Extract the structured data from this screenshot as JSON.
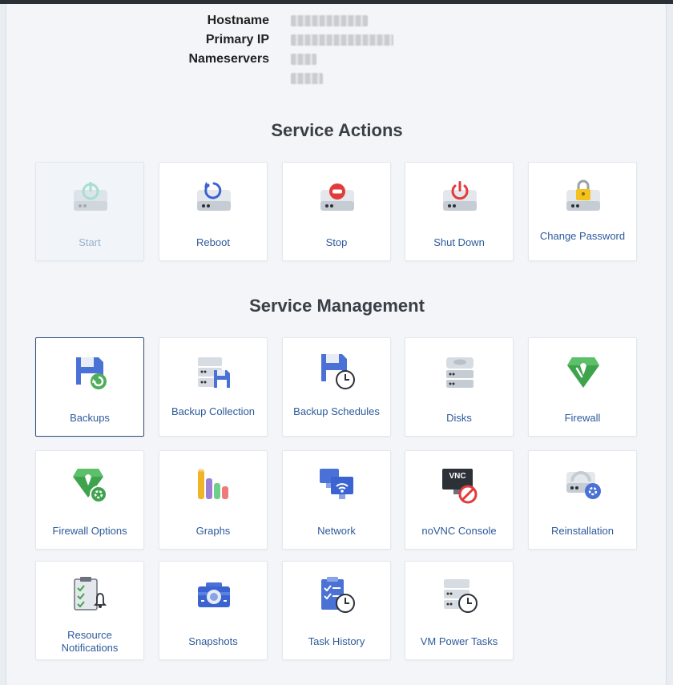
{
  "server_info": {
    "hostname_label": "Hostname",
    "primary_ip_label": "Primary IP",
    "nameservers_label": "Nameservers"
  },
  "service_actions": {
    "title": "Service Actions",
    "items": [
      {
        "label": "Start",
        "icon": "power-on-drive-icon",
        "enabled": false
      },
      {
        "label": "Reboot",
        "icon": "reboot-drive-icon",
        "enabled": true
      },
      {
        "label": "Stop",
        "icon": "stop-drive-icon",
        "enabled": true
      },
      {
        "label": "Shut Down",
        "icon": "shutdown-drive-icon",
        "enabled": true
      },
      {
        "label": "Change Password",
        "icon": "lock-drive-icon",
        "enabled": true
      }
    ]
  },
  "service_management": {
    "title": "Service Management",
    "items": [
      {
        "label": "Backups",
        "icon": "floppy-restore-icon",
        "selected": true
      },
      {
        "label": "Backup Collection",
        "icon": "server-floppy-icon"
      },
      {
        "label": "Backup Schedules",
        "icon": "floppy-clock-icon"
      },
      {
        "label": "Disks",
        "icon": "disk-stack-icon"
      },
      {
        "label": "Firewall",
        "icon": "firewall-gem-icon"
      },
      {
        "label": "Firewall Options",
        "icon": "firewall-gear-icon"
      },
      {
        "label": "Graphs",
        "icon": "bar-cylinders-icon"
      },
      {
        "label": "Network",
        "icon": "monitor-wifi-icon"
      },
      {
        "label": "noVNC Console",
        "icon": "vnc-monitor-icon"
      },
      {
        "label": "Reinstallation",
        "icon": "drive-gear-icon"
      },
      {
        "label": "Resource Notifications",
        "icon": "clipboard-bell-icon"
      },
      {
        "label": "Snapshots",
        "icon": "camera-icon"
      },
      {
        "label": "Task History",
        "icon": "clipboard-clock-icon"
      },
      {
        "label": "VM Power Tasks",
        "icon": "server-clock-icon"
      }
    ]
  },
  "colors": {
    "accent": "#2d5a9b",
    "blue_icon": "#4a72d6",
    "red_icon": "#e23b3b",
    "green_icon": "#3fa34d",
    "gray_icon": "#c6ccd4"
  }
}
